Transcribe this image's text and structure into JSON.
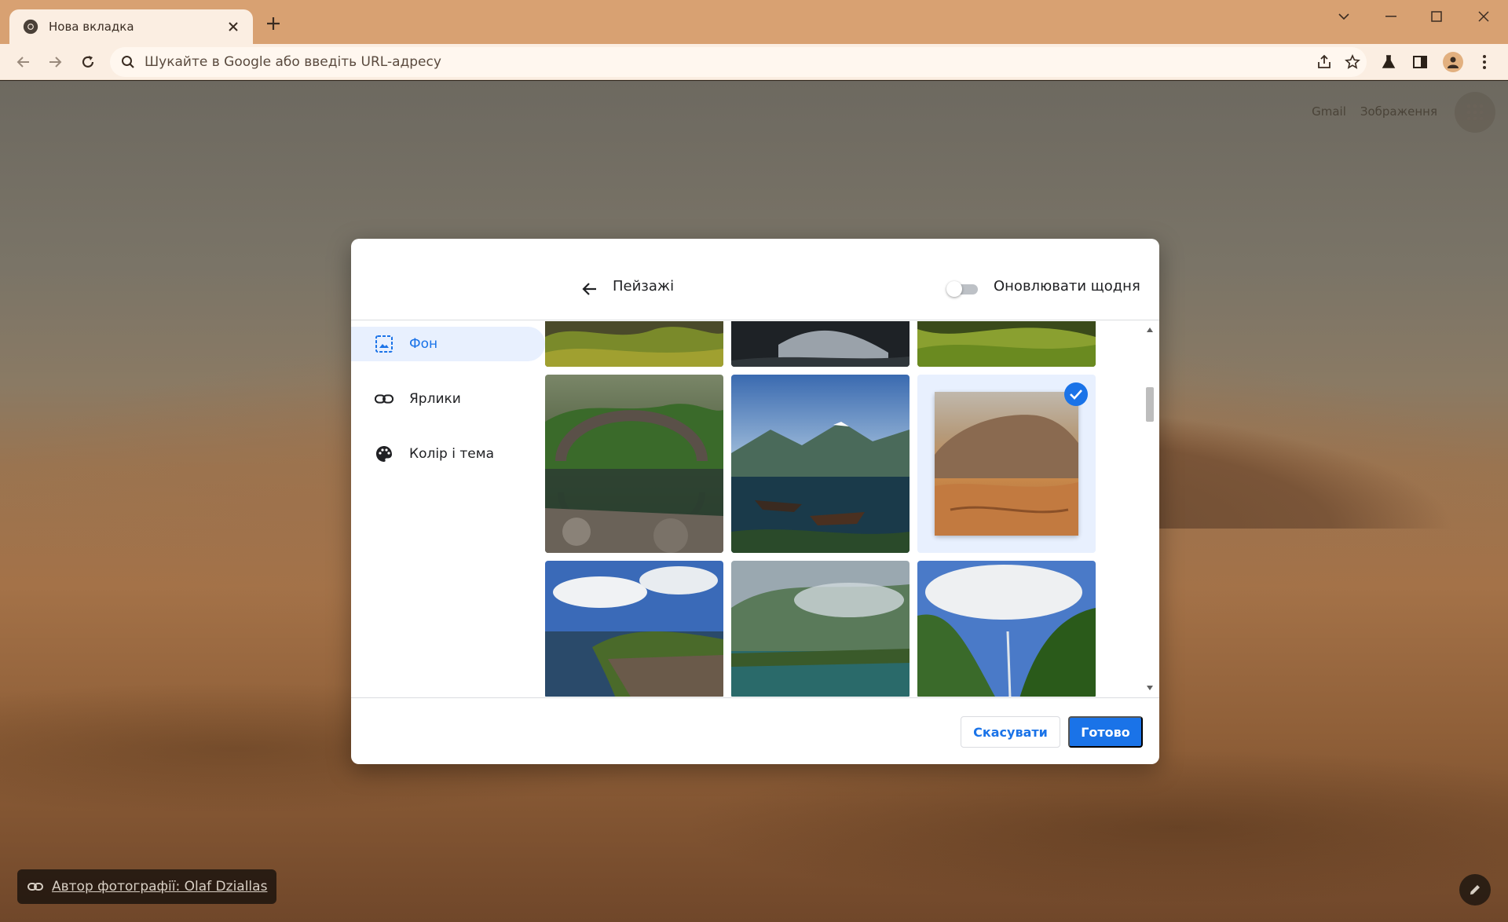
{
  "browser": {
    "tab_title": "Нова вкладка",
    "omnibox_placeholder": "Шукайте в Google або введіть URL-адресу"
  },
  "ntp": {
    "links": [
      "Gmail",
      "Зображення"
    ],
    "attribution": "Автор фотографії: Olaf Dziallas"
  },
  "dialog": {
    "title": "Пейзажі",
    "toggle_label": "Оновлювати щодня",
    "toggle_on": false,
    "sidebar": [
      {
        "label": "Фон",
        "icon": "background-icon",
        "active": true
      },
      {
        "label": "Ярлики",
        "icon": "link-icon",
        "active": false
      },
      {
        "label": "Колір і тема",
        "icon": "palette-icon",
        "active": false
      }
    ],
    "selected_tile": "desert",
    "cancel_label": "Скасувати",
    "done_label": "Готово"
  },
  "colors": {
    "tabstrip": "#d8a172",
    "toolbar": "#fbeee2",
    "accent": "#1a73e8",
    "active_sidebar_bg": "#e8f0fe"
  }
}
